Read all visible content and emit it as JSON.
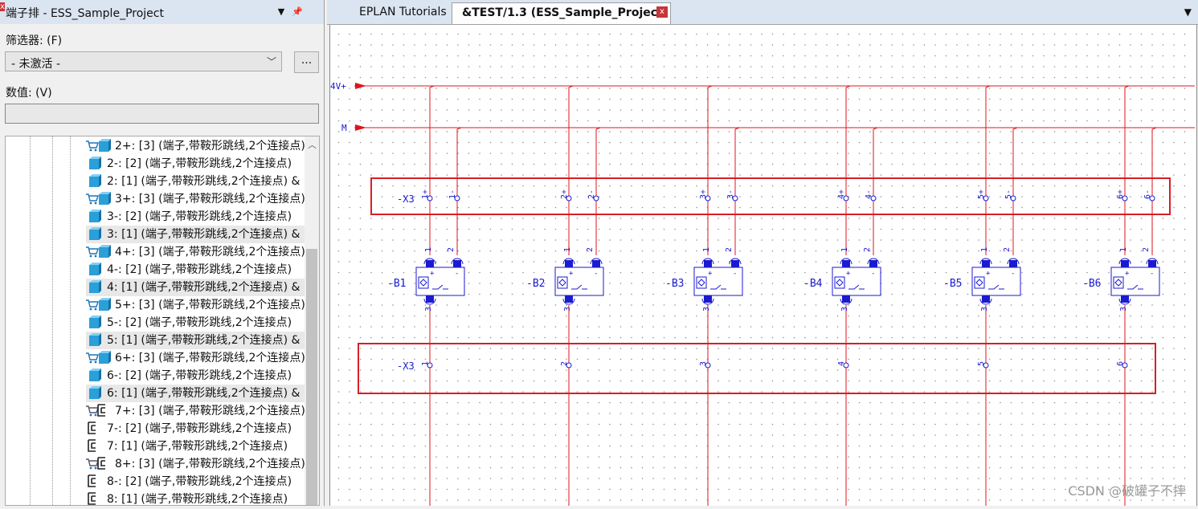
{
  "panel": {
    "title": "端子排 - ESS_Sample_Project",
    "pin_icon": "pin-icon",
    "close_label": "x",
    "filter_label": "筛选器: (F)",
    "filter_value": "- 未激活 -",
    "more_label": "...",
    "value_label": "数值: (V)",
    "value_input": ""
  },
  "tree": {
    "items": [
      {
        "label": "2+: [3] (端子,带鞍形跳线,2个连接点)",
        "icon": "terminal-cart-icon",
        "selected": false
      },
      {
        "label": "2-: [2] (端子,带鞍形跳线,2个连接点)",
        "icon": "terminal-cube-icon",
        "selected": false
      },
      {
        "label": "2: [1] (端子,带鞍形跳线,2个连接点) &",
        "icon": "terminal-cube-icon",
        "selected": false
      },
      {
        "label": "3+: [3] (端子,带鞍形跳线,2个连接点)",
        "icon": "terminal-cart-icon",
        "selected": false
      },
      {
        "label": "3-: [2] (端子,带鞍形跳线,2个连接点)",
        "icon": "terminal-cube-icon",
        "selected": false
      },
      {
        "label": "3: [1] (端子,带鞍形跳线,2个连接点) &",
        "icon": "terminal-cube-icon",
        "selected": true
      },
      {
        "label": "4+: [3] (端子,带鞍形跳线,2个连接点)",
        "icon": "terminal-cart-icon",
        "selected": false
      },
      {
        "label": "4-: [2] (端子,带鞍形跳线,2个连接点)",
        "icon": "terminal-cube-icon",
        "selected": false
      },
      {
        "label": "4: [1] (端子,带鞍形跳线,2个连接点) &",
        "icon": "terminal-cube-icon",
        "selected": true
      },
      {
        "label": "5+: [3] (端子,带鞍形跳线,2个连接点)",
        "icon": "terminal-cart-icon",
        "selected": false
      },
      {
        "label": "5-: [2] (端子,带鞍形跳线,2个连接点)",
        "icon": "terminal-cube-icon",
        "selected": false
      },
      {
        "label": "5: [1] (端子,带鞍形跳线,2个连接点) &",
        "icon": "terminal-cube-icon",
        "selected": true
      },
      {
        "label": "6+: [3] (端子,带鞍形跳线,2个连接点)",
        "icon": "terminal-cart-icon",
        "selected": false
      },
      {
        "label": "6-: [2] (端子,带鞍形跳线,2个连接点)",
        "icon": "terminal-cube-icon",
        "selected": false
      },
      {
        "label": "6: [1] (端子,带鞍形跳线,2个连接点) &",
        "icon": "terminal-cube-icon",
        "selected": true
      },
      {
        "label": "7+: [3] (端子,带鞍形跳线,2个连接点)",
        "icon": "terminal-cart-outline-icon",
        "selected": false
      },
      {
        "label": "7-: [2] (端子,带鞍形跳线,2个连接点)",
        "icon": "terminal-outline-icon",
        "selected": false
      },
      {
        "label": "7: [1] (端子,带鞍形跳线,2个连接点)",
        "icon": "terminal-outline-icon",
        "selected": false
      },
      {
        "label": "8+: [3] (端子,带鞍形跳线,2个连接点)",
        "icon": "terminal-cart-outline-icon",
        "selected": false
      },
      {
        "label": "8-: [2] (端子,带鞍形跳线,2个连接点)",
        "icon": "terminal-outline-icon",
        "selected": false
      },
      {
        "label": "8: [1] (端子,带鞍形跳线,2个连接点)",
        "icon": "terminal-outline-icon",
        "selected": false
      }
    ]
  },
  "tabs": [
    {
      "label": "EPLAN Tutorials",
      "active": false
    },
    {
      "label": "&TEST/1.3 (ESS_Sample_Project)",
      "active": true
    }
  ],
  "tab_close_label": "x",
  "schematic": {
    "bus_labels": [
      "4V+",
      "M"
    ],
    "strip_top": "-X3",
    "strip_bottom": "-X3",
    "top_terminals": [
      [
        "1+",
        "1-"
      ],
      [
        "2+",
        "2-"
      ],
      [
        "3+",
        "3-"
      ],
      [
        "4+",
        "4-"
      ],
      [
        "5+",
        "5-"
      ],
      [
        "6+",
        "6-"
      ]
    ],
    "bottom_terminals": [
      "1",
      "2",
      "3",
      "4",
      "5",
      "6"
    ],
    "devices": [
      "-B1",
      "-B2",
      "-B3",
      "-B4",
      "-B5",
      "-B6"
    ],
    "device_pins": {
      "top_left": "1",
      "top_right": "2",
      "bottom": "3"
    },
    "colors": {
      "wire": "#e0141e",
      "symbol": "#1a1ad0",
      "grid": "#9a9a9a"
    }
  },
  "watermark": "CSDN @破罐子不摔"
}
